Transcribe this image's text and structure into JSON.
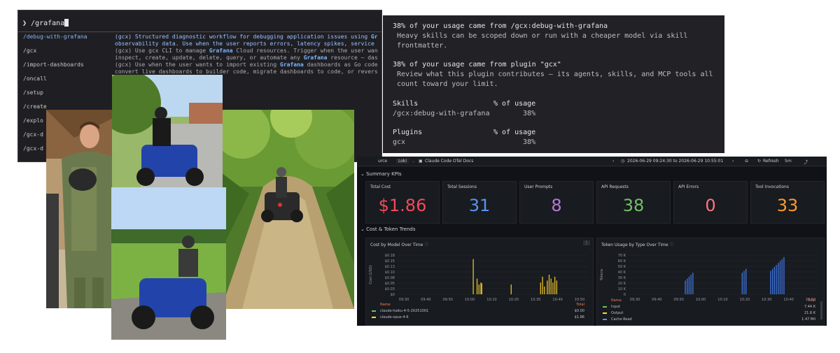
{
  "terminal": {
    "command": "/grafana",
    "rows": [
      {
        "cmd": "/debug-with-grafana",
        "lines": [
          "(gcx) Structured diagnostic workflow for debugging application issues using Grafana",
          "observability data. Use when the user reports errors, latency spikes, service degrad"
        ],
        "selected": true
      },
      {
        "cmd": "/gcx",
        "lines": [
          "(gcx) Use gcx CLI to manage Grafana Cloud resources. Trigger when the user wants to",
          "inspect, create, update, delete, query, or automate any Grafana resource — dashboar"
        ],
        "selected": false
      },
      {
        "cmd": "/import-dashboards",
        "lines": [
          "(gcx) Use when the user wants to import existing Grafana dashboards as Go code,",
          "convert live dashboards to builder code, migrate dashboards to code, or reverse-eng"
        ],
        "selected": false
      },
      {
        "cmd": "/oncall",
        "lines": [
          "",
          ""
        ],
        "selected": false
      },
      {
        "cmd": "/setup",
        "lines": [
          "",
          ""
        ],
        "selected": false
      },
      {
        "cmd": "/create",
        "lines": [
          "",
          ""
        ],
        "selected": false
      },
      {
        "cmd": "/explo",
        "lines": [
          "",
          ""
        ],
        "selected": false
      },
      {
        "cmd": "/gcx-d",
        "lines": [
          "",
          ""
        ],
        "selected": false
      },
      {
        "cmd": "/gcx-d",
        "lines": [
          "",
          ""
        ],
        "selected": false
      }
    ]
  },
  "usage": {
    "line1_head": "38% of your usage came from /gcx:debug-with-grafana",
    "line1_body": [
      "Heavy skills can be scoped down or run with a cheaper model via skill",
      "frontmatter."
    ],
    "line2_head": "38% of your usage came from plugin \"gcx\"",
    "line2_body": [
      "Review what this plugin contributes — its agents, skills, and MCP tools all",
      "count toward your limit."
    ],
    "skills_header": "Skills",
    "pct_header": "% of usage",
    "skill_name": "/gcx:debug-with-grafana",
    "skill_pct": "38%",
    "plugins_header": "Plugins",
    "plugin_name": "gcx",
    "plugin_pct": "38%"
  },
  "grafana": {
    "datasource_label": "urce",
    "datasource": "Loki",
    "docs_link": "Claude Code OTel Docs",
    "time_range": "2026-06-29 09:24:30 to 2026-06-29 10:55:01",
    "refresh": "Refresh",
    "interval": "5m",
    "section_kpis": "Summary KPIs",
    "section_trends": "Cost & Token Trends",
    "kpis": [
      {
        "title": "Total Cost",
        "value": "$1.86",
        "color": "#f2495c"
      },
      {
        "title": "Total Sessions",
        "value": "31",
        "color": "#5794f2"
      },
      {
        "title": "User Prompts",
        "value": "8",
        "color": "#b877d9"
      },
      {
        "title": "API Requests",
        "value": "38",
        "color": "#73bf69"
      },
      {
        "title": "API Errors",
        "value": "0",
        "color": "#ff7383"
      },
      {
        "title": "Tool Invocations",
        "value": "33",
        "color": "#ff9830"
      }
    ],
    "panels": {
      "cost": {
        "title": "Cost by Model Over Time",
        "ylabel": "Cost (USD)",
        "yticks": [
          "$0.18",
          "$0.15",
          "$0.13",
          "$0.10",
          "$0.08",
          "$0.05",
          "$0.03",
          "$0"
        ],
        "xticks": [
          "09:30",
          "09:40",
          "09:50",
          "10:00",
          "10:10",
          "10:20",
          "10:30",
          "10:40",
          "10:50"
        ],
        "legend_name": "Name",
        "legend_total": "Total",
        "legend": [
          {
            "name": "claude-haiku-4-5-20251001",
            "total": "$0.00",
            "color": "#73bf69"
          },
          {
            "name": "claude-opus-4-6",
            "total": "$1.86",
            "color": "#fade2a"
          }
        ]
      },
      "tokens": {
        "title": "Token Usage by Type Over Time",
        "ylabel": "Tokens",
        "yticks": [
          "70 K",
          "60 K",
          "50 K",
          "40 K",
          "30 K",
          "20 K",
          "10 K",
          "0"
        ],
        "xticks": [
          "09:30",
          "09:40",
          "09:50",
          "10:00",
          "10:10",
          "10:20",
          "10:30",
          "10:40",
          "10:50"
        ],
        "legend_name": "Name",
        "legend_total": "Total",
        "legend": [
          {
            "name": "Input",
            "total": "7.44 K",
            "color": "#73bf69"
          },
          {
            "name": "Output",
            "total": "21.8 K",
            "color": "#fade2a"
          },
          {
            "name": "Cache Read",
            "total": "1.47 Mil",
            "color": "#5794f2"
          }
        ]
      }
    }
  }
}
